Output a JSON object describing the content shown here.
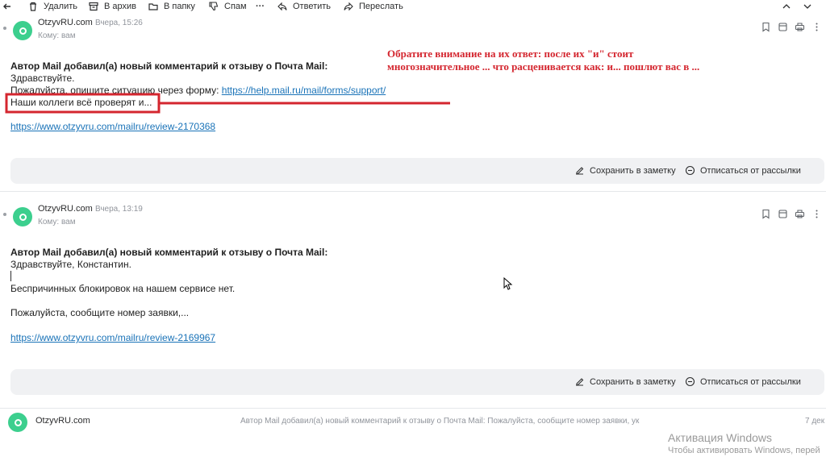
{
  "toolbar": {
    "delete_label": "Удалить",
    "archive_label": "В архив",
    "folder_label": "В папку",
    "spam_label": "Спам",
    "more_label": "···",
    "reply_label": "Ответить",
    "forward_label": "Переслать"
  },
  "messages": [
    {
      "sender": "OtzyvRU.com",
      "date": "Вчера, 15:26",
      "to_prefix": "Кому:",
      "to_name": "вам",
      "heading": "Автор Mail добавил(а) новый комментарий к отзыву о Почта Mail:",
      "lines": [
        "Здравствуйте.",
        "Пожалуйста, опишите ситуацию через форму:",
        "Наши коллеги всё проверят и..."
      ],
      "form_link": "https://help.mail.ru/mail/forms/support/",
      "review_link": "https://www.otzyvru.com/mailru/review-2170368",
      "save_note_label": "Сохранить в заметку",
      "unsubscribe_label": "Отписаться от рассылки"
    },
    {
      "sender": "OtzyvRU.com",
      "date": "Вчера, 13:19",
      "to_prefix": "Кому:",
      "to_name": "вам",
      "heading": "Автор Mail добавил(а) новый комментарий к отзыву о Почта Mail:",
      "lines": [
        "Здравствуйте, Константин.",
        "Беспричинных блокировок на нашем сервисе нет.",
        "Пожалуйста, сообщите номер заявки,..."
      ],
      "review_link": "https://www.otzyvru.com/mailru/review-2169967",
      "save_note_label": "Сохранить в заметку",
      "unsubscribe_label": "Отписаться от рассылки"
    }
  ],
  "collapsed": {
    "sender": "OtzyvRU.com",
    "snippet": "Автор Mail добавил(а) новый комментарий к отзыву о Почта Mail: Пожалуйста, сообщите номер заявки, ук",
    "date": "7 дек"
  },
  "annotation": {
    "text": "Обратите внимание на их ответ:  после их \"и\" стоит многозначительное ... что расценивается как: и... пошлют вас в ..."
  },
  "windows_activation": {
    "title": "Активация Windows",
    "subtitle": "Чтобы активировать Windows, перей"
  },
  "colors": {
    "accent_link": "#1a73b8",
    "annotation_red": "#d4262f",
    "avatar_green": "#3ccf8e"
  }
}
